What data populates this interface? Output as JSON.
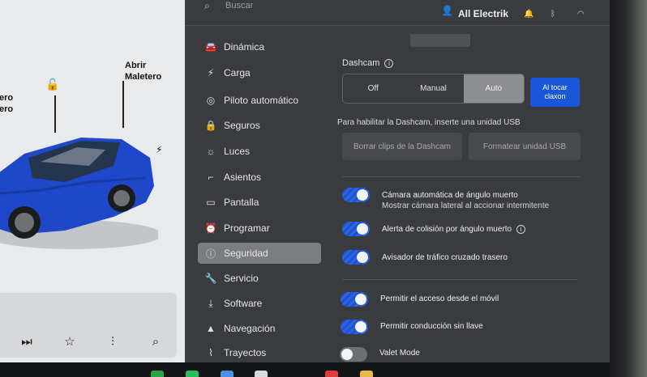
{
  "car_panel": {
    "lock_label_line1": "ero",
    "lock_label_line2": "ero",
    "trunk_label_line1": "Abrir",
    "trunk_label_line2": "Maletero",
    "media_controls": [
      "next-track-icon",
      "star-icon",
      "equalizer-icon",
      "search-icon"
    ]
  },
  "header": {
    "search_placeholder": "Buscar",
    "user_name": "All Electrik",
    "status_icons": [
      "bell-icon",
      "bluetooth-icon",
      "wifi-icon"
    ]
  },
  "nav": {
    "items": [
      {
        "label": "Dinámica",
        "icon": "car-icon"
      },
      {
        "label": "Carga",
        "icon": "bolt-icon"
      },
      {
        "label": "Piloto automático",
        "icon": "steering-wheel-icon"
      },
      {
        "label": "Seguros",
        "icon": "lock-icon"
      },
      {
        "label": "Luces",
        "icon": "sun-icon"
      },
      {
        "label": "Asientos",
        "icon": "seat-icon"
      },
      {
        "label": "Pantalla",
        "icon": "display-icon"
      },
      {
        "label": "Programar",
        "icon": "alarm-clock-icon"
      },
      {
        "label": "Seguridad",
        "icon": "info-circle-icon",
        "active": true
      },
      {
        "label": "Servicio",
        "icon": "wrench-icon"
      },
      {
        "label": "Software",
        "icon": "download-icon"
      },
      {
        "label": "Navegación",
        "icon": "navigation-arrow-icon"
      },
      {
        "label": "Trayectos",
        "icon": "trips-icon"
      }
    ]
  },
  "dashcam": {
    "heading": "Dashcam",
    "options": [
      "Off",
      "Manual",
      "Auto"
    ],
    "selected": "Auto",
    "blue_button_line1": "Al tocar",
    "blue_button_line2": "claxon",
    "usb_note": "Para habilitar la Dashcam, inserte una unidad USB",
    "delete_clips": "Borrar clips de la Dashcam",
    "format_usb": "Formatear unidad USB"
  },
  "toggles": {
    "blindspot_camera": {
      "label": "Cámara automática de ángulo muerto",
      "sublabel": "Mostrar cámara lateral al accionar intermitente",
      "on": true
    },
    "blindspot_alert": {
      "label": "Alerta de colisión por ángulo muerto",
      "on": true
    },
    "cross_traffic": {
      "label": "Avisador de tráfico cruzado trasero",
      "on": true
    },
    "mobile_access": {
      "label": "Permitir el acceso desde el móvil",
      "on": true
    },
    "keyless_drive": {
      "label": "Permitir conducción sin llave",
      "on": true
    },
    "valet_mode": {
      "label": "Valet Mode",
      "on": false
    }
  },
  "colors": {
    "accent_blue": "#1a56d8",
    "panel_bg": "#3a3b3e",
    "active_nav": "#7c7d81",
    "car_blue": "#1f47c9"
  }
}
